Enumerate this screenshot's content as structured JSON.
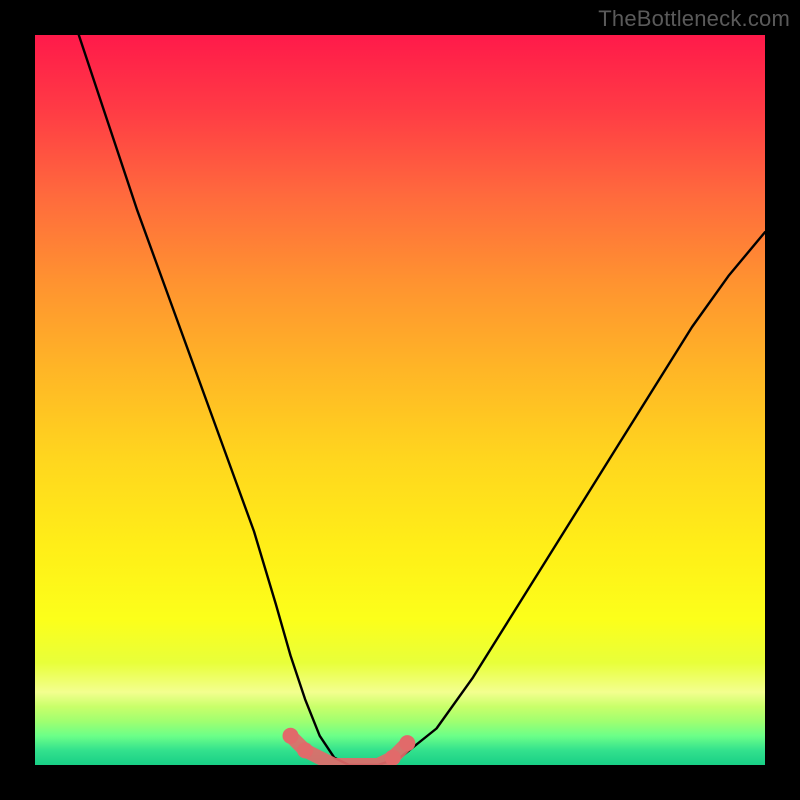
{
  "watermark": "TheBottleneck.com",
  "chart_data": {
    "type": "line",
    "title": "",
    "xlabel": "",
    "ylabel": "",
    "xlim": [
      0,
      100
    ],
    "ylim": [
      0,
      100
    ],
    "series": [
      {
        "name": "bottleneck-curve",
        "x": [
          6,
          10,
          14,
          18,
          22,
          26,
          30,
          33,
          35,
          37,
          39,
          41,
          43,
          45,
          47,
          50,
          55,
          60,
          65,
          70,
          75,
          80,
          85,
          90,
          95,
          100
        ],
        "y": [
          100,
          88,
          76,
          65,
          54,
          43,
          32,
          22,
          15,
          9,
          4,
          1,
          0,
          0,
          0,
          1,
          5,
          12,
          20,
          28,
          36,
          44,
          52,
          60,
          67,
          73
        ]
      }
    ],
    "highlight": {
      "name": "optimal-range",
      "x": [
        35,
        37,
        39,
        41,
        43,
        45,
        47,
        49,
        51
      ],
      "y": [
        4,
        2,
        1,
        0,
        0,
        0,
        0,
        1,
        3
      ]
    },
    "gradient_stops": [
      {
        "pct": 0,
        "color": "#ff1a4a"
      },
      {
        "pct": 50,
        "color": "#ffd61e"
      },
      {
        "pct": 90,
        "color": "#f3ff8f"
      },
      {
        "pct": 100,
        "color": "#18cf86"
      }
    ]
  }
}
